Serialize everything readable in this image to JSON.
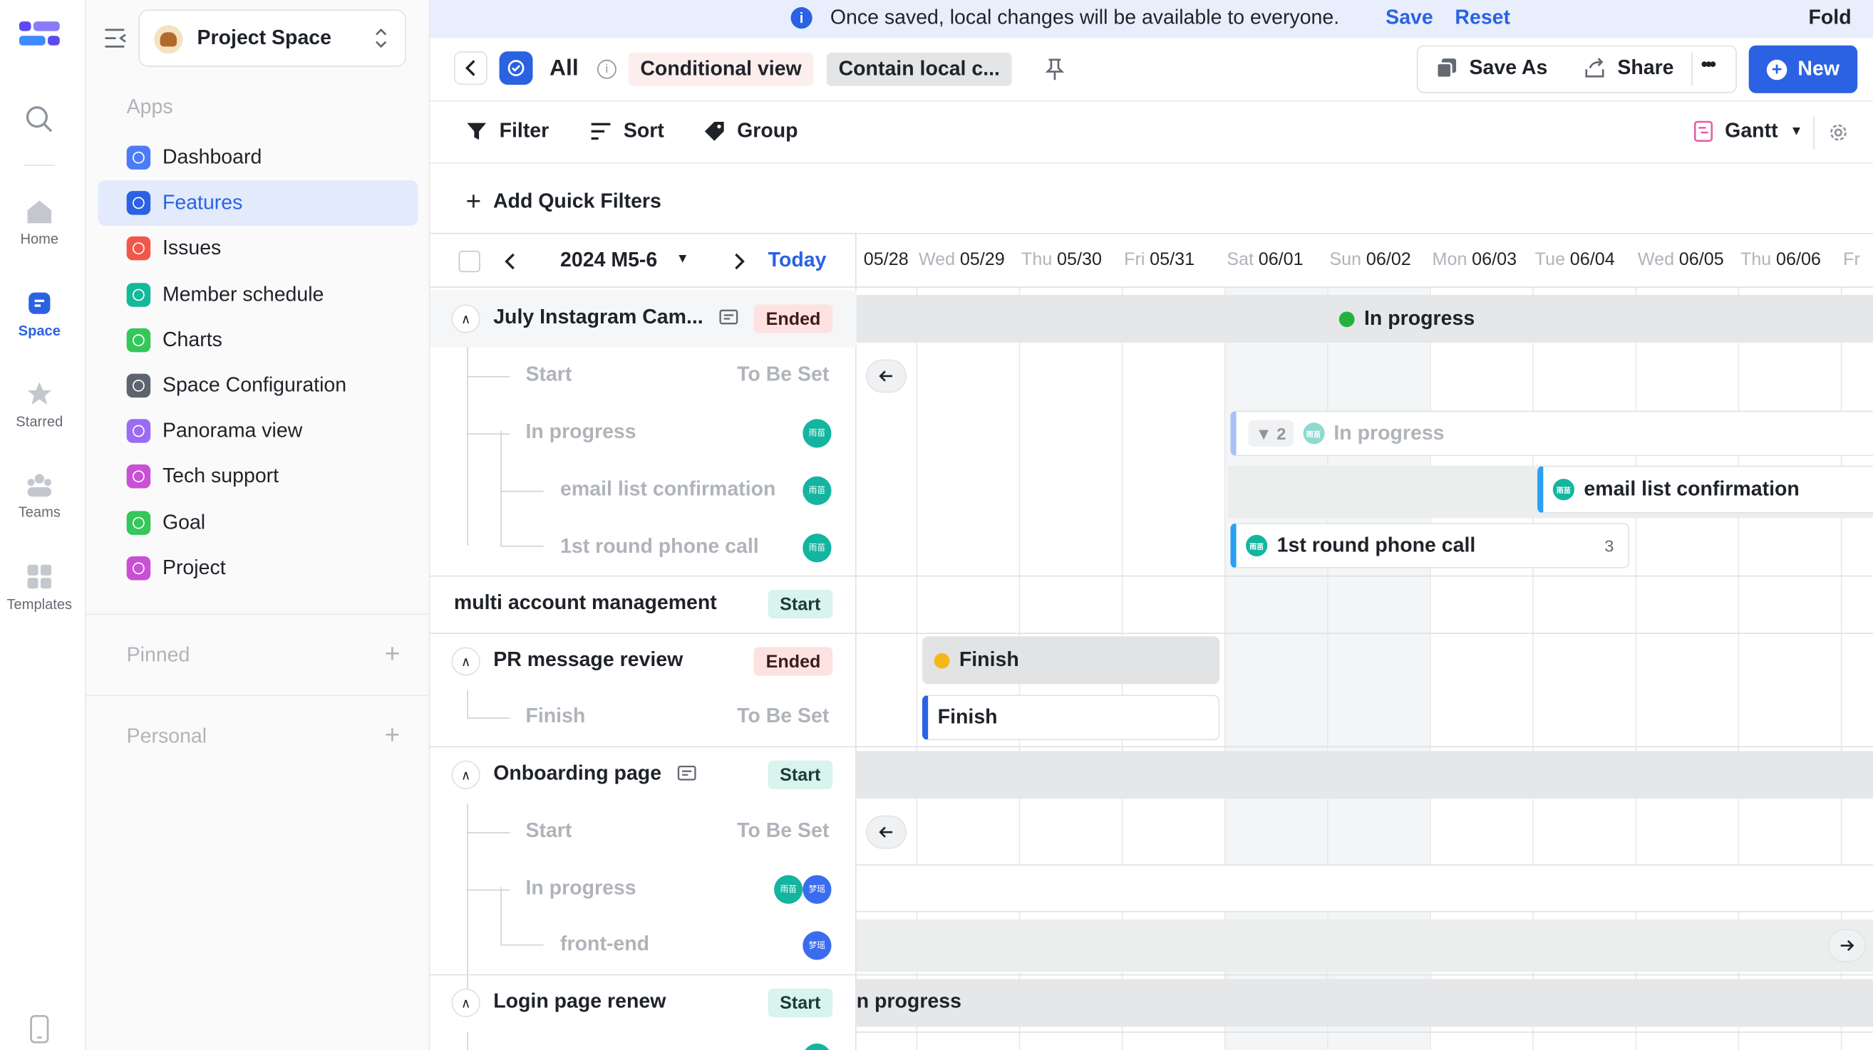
{
  "rail": {
    "items": [
      {
        "label": "Home",
        "icon": "home-icon"
      },
      {
        "label": "Space",
        "icon": "space-icon",
        "active": true
      },
      {
        "label": "Starred",
        "icon": "star-icon"
      },
      {
        "label": "Teams",
        "icon": "teams-icon"
      },
      {
        "label": "Templates",
        "icon": "templates-icon"
      }
    ]
  },
  "sidebar": {
    "space_name": "Project Space",
    "apps_heading": "Apps",
    "apps": [
      {
        "label": "Dashboard",
        "color": "#4c7cf5"
      },
      {
        "label": "Features",
        "color": "#2b62e3"
      },
      {
        "label": "Issues",
        "color": "#f0574a"
      },
      {
        "label": "Member schedule",
        "color": "#14b89a"
      },
      {
        "label": "Charts",
        "color": "#34c759"
      },
      {
        "label": "Space Configuration",
        "color": "#5d6470"
      },
      {
        "label": "Panorama view",
        "color": "#9b6cf3"
      },
      {
        "label": "Tech support",
        "color": "#c94fd4"
      },
      {
        "label": "Goal",
        "color": "#34c759"
      },
      {
        "label": "Project",
        "color": "#c94fd4"
      }
    ],
    "pinned": "Pinned",
    "personal": "Personal"
  },
  "banner": {
    "message": "Once saved, local changes will be available to everyone.",
    "save": "Save",
    "reset": "Reset",
    "fold": "Fold"
  },
  "toolbar": {
    "view_name": "All",
    "tag_conditional": "Conditional view",
    "tag_local": "Contain local c...",
    "save_as": "Save As",
    "share": "Share",
    "more": "•••",
    "new": "New"
  },
  "filters": {
    "filter": "Filter",
    "sort": "Sort",
    "group": "Group",
    "view_mode": "Gantt",
    "add_quick": "Add Quick Filters"
  },
  "timeline": {
    "range": "2024 M5-6",
    "today": "Today",
    "days": [
      {
        "dow": "",
        "date": "05/28"
      },
      {
        "dow": "Wed",
        "date": "05/29"
      },
      {
        "dow": "Thu",
        "date": "05/30"
      },
      {
        "dow": "Fri",
        "date": "05/31"
      },
      {
        "dow": "Sat",
        "date": "06/01"
      },
      {
        "dow": "Sun",
        "date": "06/02"
      },
      {
        "dow": "Mon",
        "date": "06/03"
      },
      {
        "dow": "Tue",
        "date": "06/04"
      },
      {
        "dow": "Wed",
        "date": "06/05"
      },
      {
        "dow": "Thu",
        "date": "06/06"
      },
      {
        "dow": "Fr",
        "date": ""
      }
    ]
  },
  "rows": {
    "r1": {
      "title": "July Instagram Cam...",
      "status": "Ended"
    },
    "r1a": {
      "title": "Start",
      "value": "To Be Set"
    },
    "r1b": {
      "title": "In progress",
      "avatar": "雨苗"
    },
    "r1c": {
      "title": "email list confirmation",
      "avatar": "雨苗"
    },
    "r1d": {
      "title": "1st round phone call",
      "avatar": "雨苗"
    },
    "r2": {
      "title": "multi account management",
      "status": "Start"
    },
    "r3": {
      "title": "PR message review",
      "status": "Ended"
    },
    "r3a": {
      "title": "Finish",
      "value": "To Be Set"
    },
    "r4": {
      "title": "Onboarding page",
      "status": "Start"
    },
    "r4a": {
      "title": "Start",
      "value": "To Be Set"
    },
    "r4b": {
      "title": "In progress",
      "avatar1": "雨苗",
      "avatar2": "梦瑶"
    },
    "r4c": {
      "title": "front-end",
      "avatar": "梦瑶"
    },
    "r5": {
      "title": "Login page renew",
      "status": "Start"
    }
  },
  "gantt": {
    "g1": "In progress",
    "g1b_count": "▼ 2",
    "g1b": "In progress",
    "g1c": "email list confirmation",
    "g1d": "1st round phone call",
    "g1d_count": "3",
    "g3": "Finish",
    "g3a": "Finish",
    "g5": "n progress",
    "avatar": "雨苗"
  }
}
